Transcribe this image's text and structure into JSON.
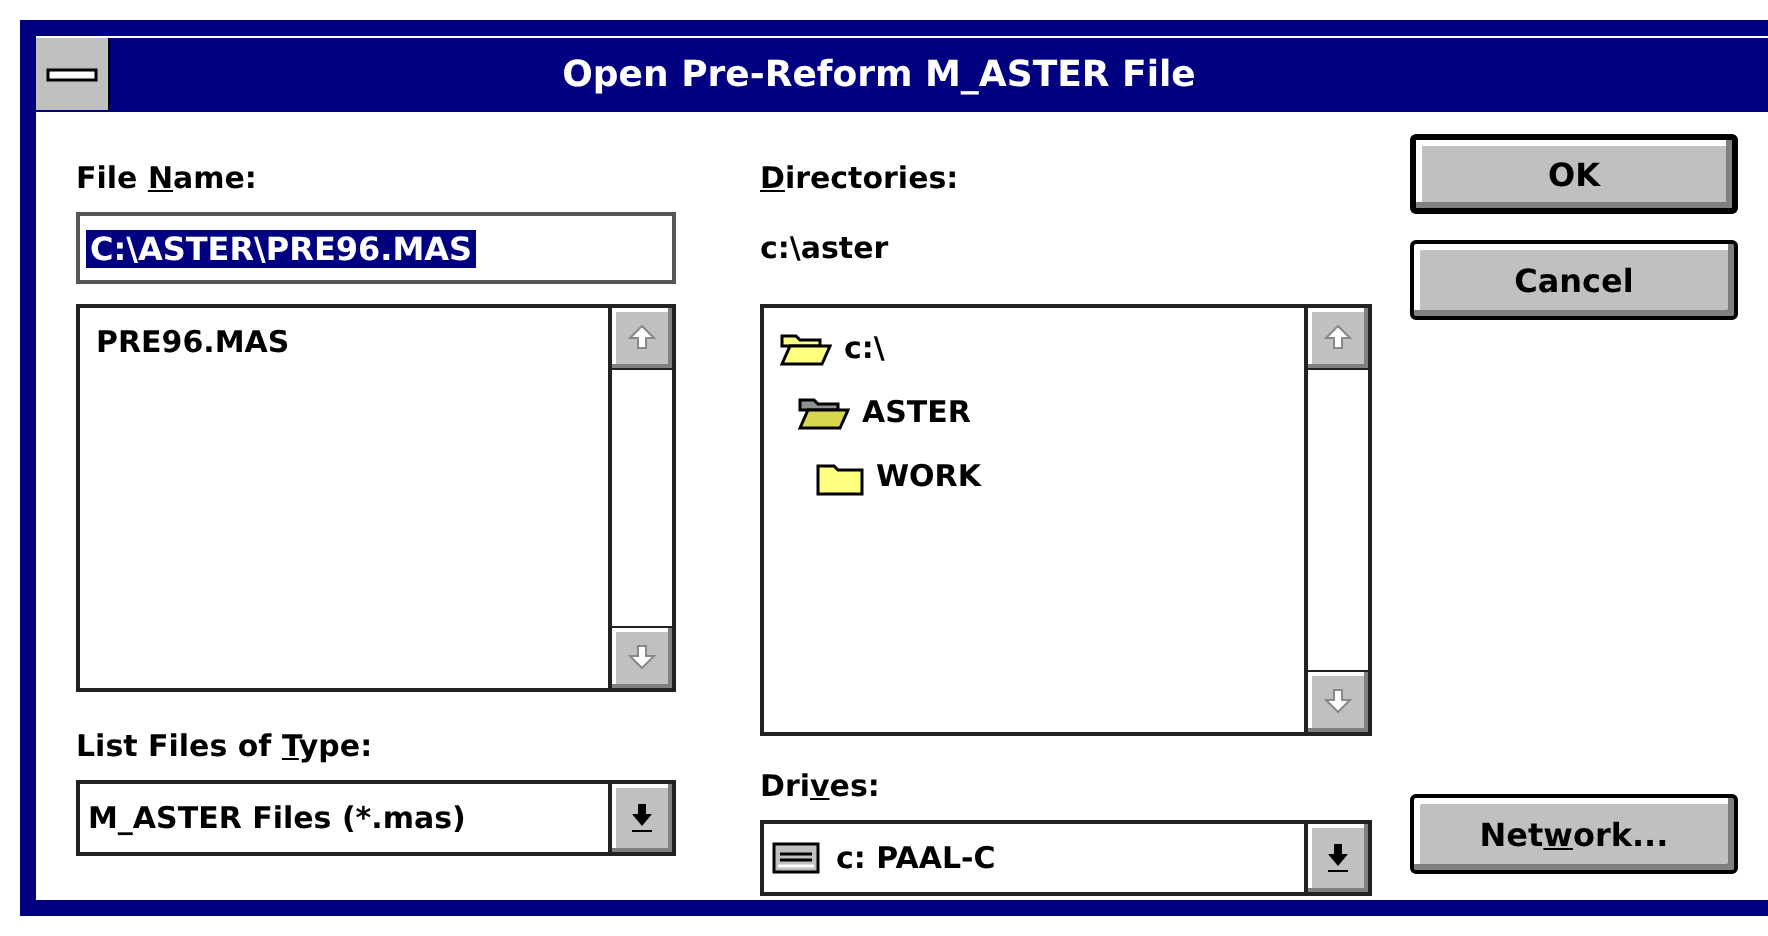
{
  "window": {
    "title": "Open Pre-Reform M_ASTER File"
  },
  "file_name": {
    "label": {
      "before": "File ",
      "key": "N",
      "after": "ame:"
    },
    "value": "C:\\ASTER\\PRE96.MAS"
  },
  "files": {
    "items": [
      {
        "name": "PRE96.MAS"
      }
    ]
  },
  "directories": {
    "label": {
      "key": "D",
      "after": "irectories:"
    },
    "current": "c:\\aster",
    "tree": [
      {
        "name": "c:\\",
        "kind": "open",
        "children": [
          {
            "name": "ASTER",
            "kind": "current",
            "children": [
              {
                "name": "WORK",
                "kind": "closed"
              }
            ]
          }
        ]
      }
    ]
  },
  "file_type": {
    "label": {
      "before": "List Files of ",
      "key": "T",
      "after": "ype:"
    },
    "value": "M_ASTER Files (*.mas)"
  },
  "drives": {
    "label": {
      "before": "Dri",
      "key": "v",
      "after": "es:"
    },
    "value": "c: PAAL-C"
  },
  "buttons": [
    {
      "label": {
        "before": "OK"
      },
      "default": true
    },
    {
      "label": {
        "before": "Cancel"
      },
      "default": false
    },
    {
      "label": {
        "before": "Net",
        "key": "w",
        "after": "ork..."
      },
      "default": false
    }
  ]
}
